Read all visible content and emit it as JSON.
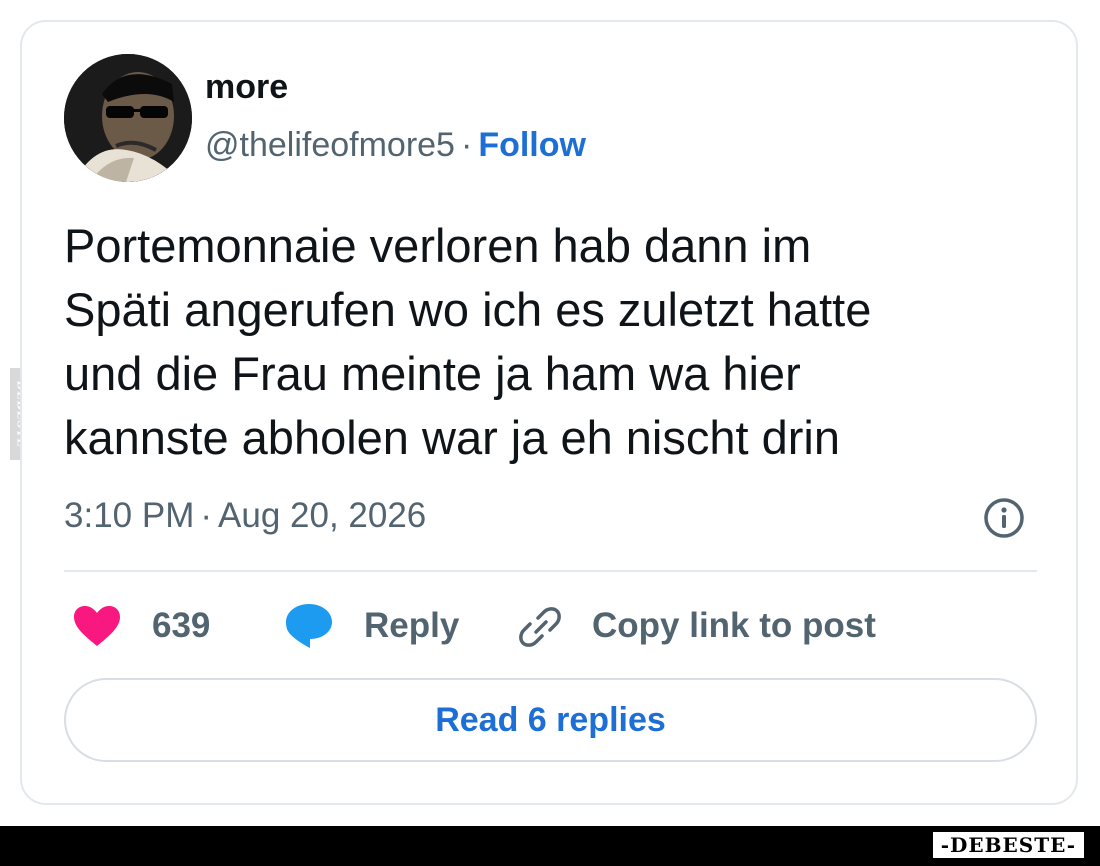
{
  "watermark": {
    "side_text": "DEBESTE",
    "logo_text": "-DEBESTE-"
  },
  "tweet": {
    "author_name": "more",
    "handle": "@thelifeofmore5",
    "separator": "·",
    "follow_label": "Follow",
    "text_lines": [
      "Portemonnaie verloren hab dann im",
      "Späti angerufen wo ich es zuletzt hatte",
      "und die Frau meinte ja ham wa hier",
      "kannste abholen war ja eh nischt drin"
    ],
    "time": "3:10 PM",
    "date": "Aug 20, 2026"
  },
  "actions": {
    "like_count": "639",
    "reply_label": "Reply",
    "copy_link_label": "Copy link to post"
  },
  "read_replies_label": "Read 6 replies",
  "icons": {
    "avatar": "avatar",
    "info": "info-icon",
    "like": "heart-icon",
    "reply": "speech-bubble-icon",
    "copy": "link-icon"
  },
  "colors": {
    "accent": "#1d6fd6",
    "heart": "#f91880",
    "reply_bubble": "#1d9bf0",
    "muted_text": "#536471",
    "border": "#e3e8ec"
  }
}
